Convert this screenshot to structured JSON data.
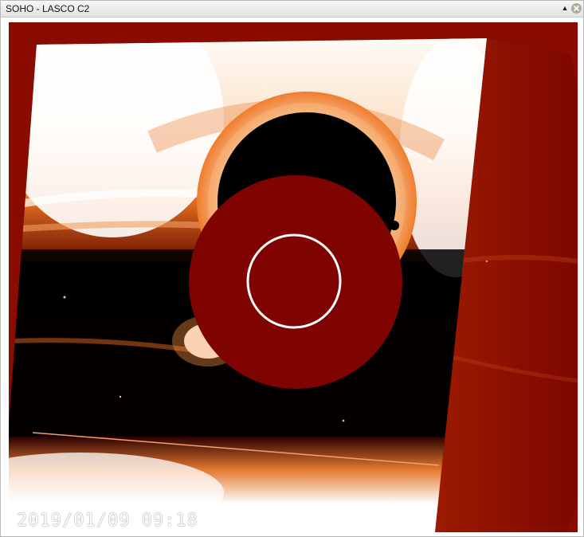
{
  "window": {
    "title": "SOHO - LASCO C2"
  },
  "image": {
    "timestamp": "2019/01/09 09:18"
  },
  "colors": {
    "titlebar": "#e8e8e8",
    "occulter": "#7f0300",
    "background": "#8a0b00"
  },
  "icons": {
    "collapse": "triangle-up-icon",
    "close": "close-circle-icon"
  }
}
